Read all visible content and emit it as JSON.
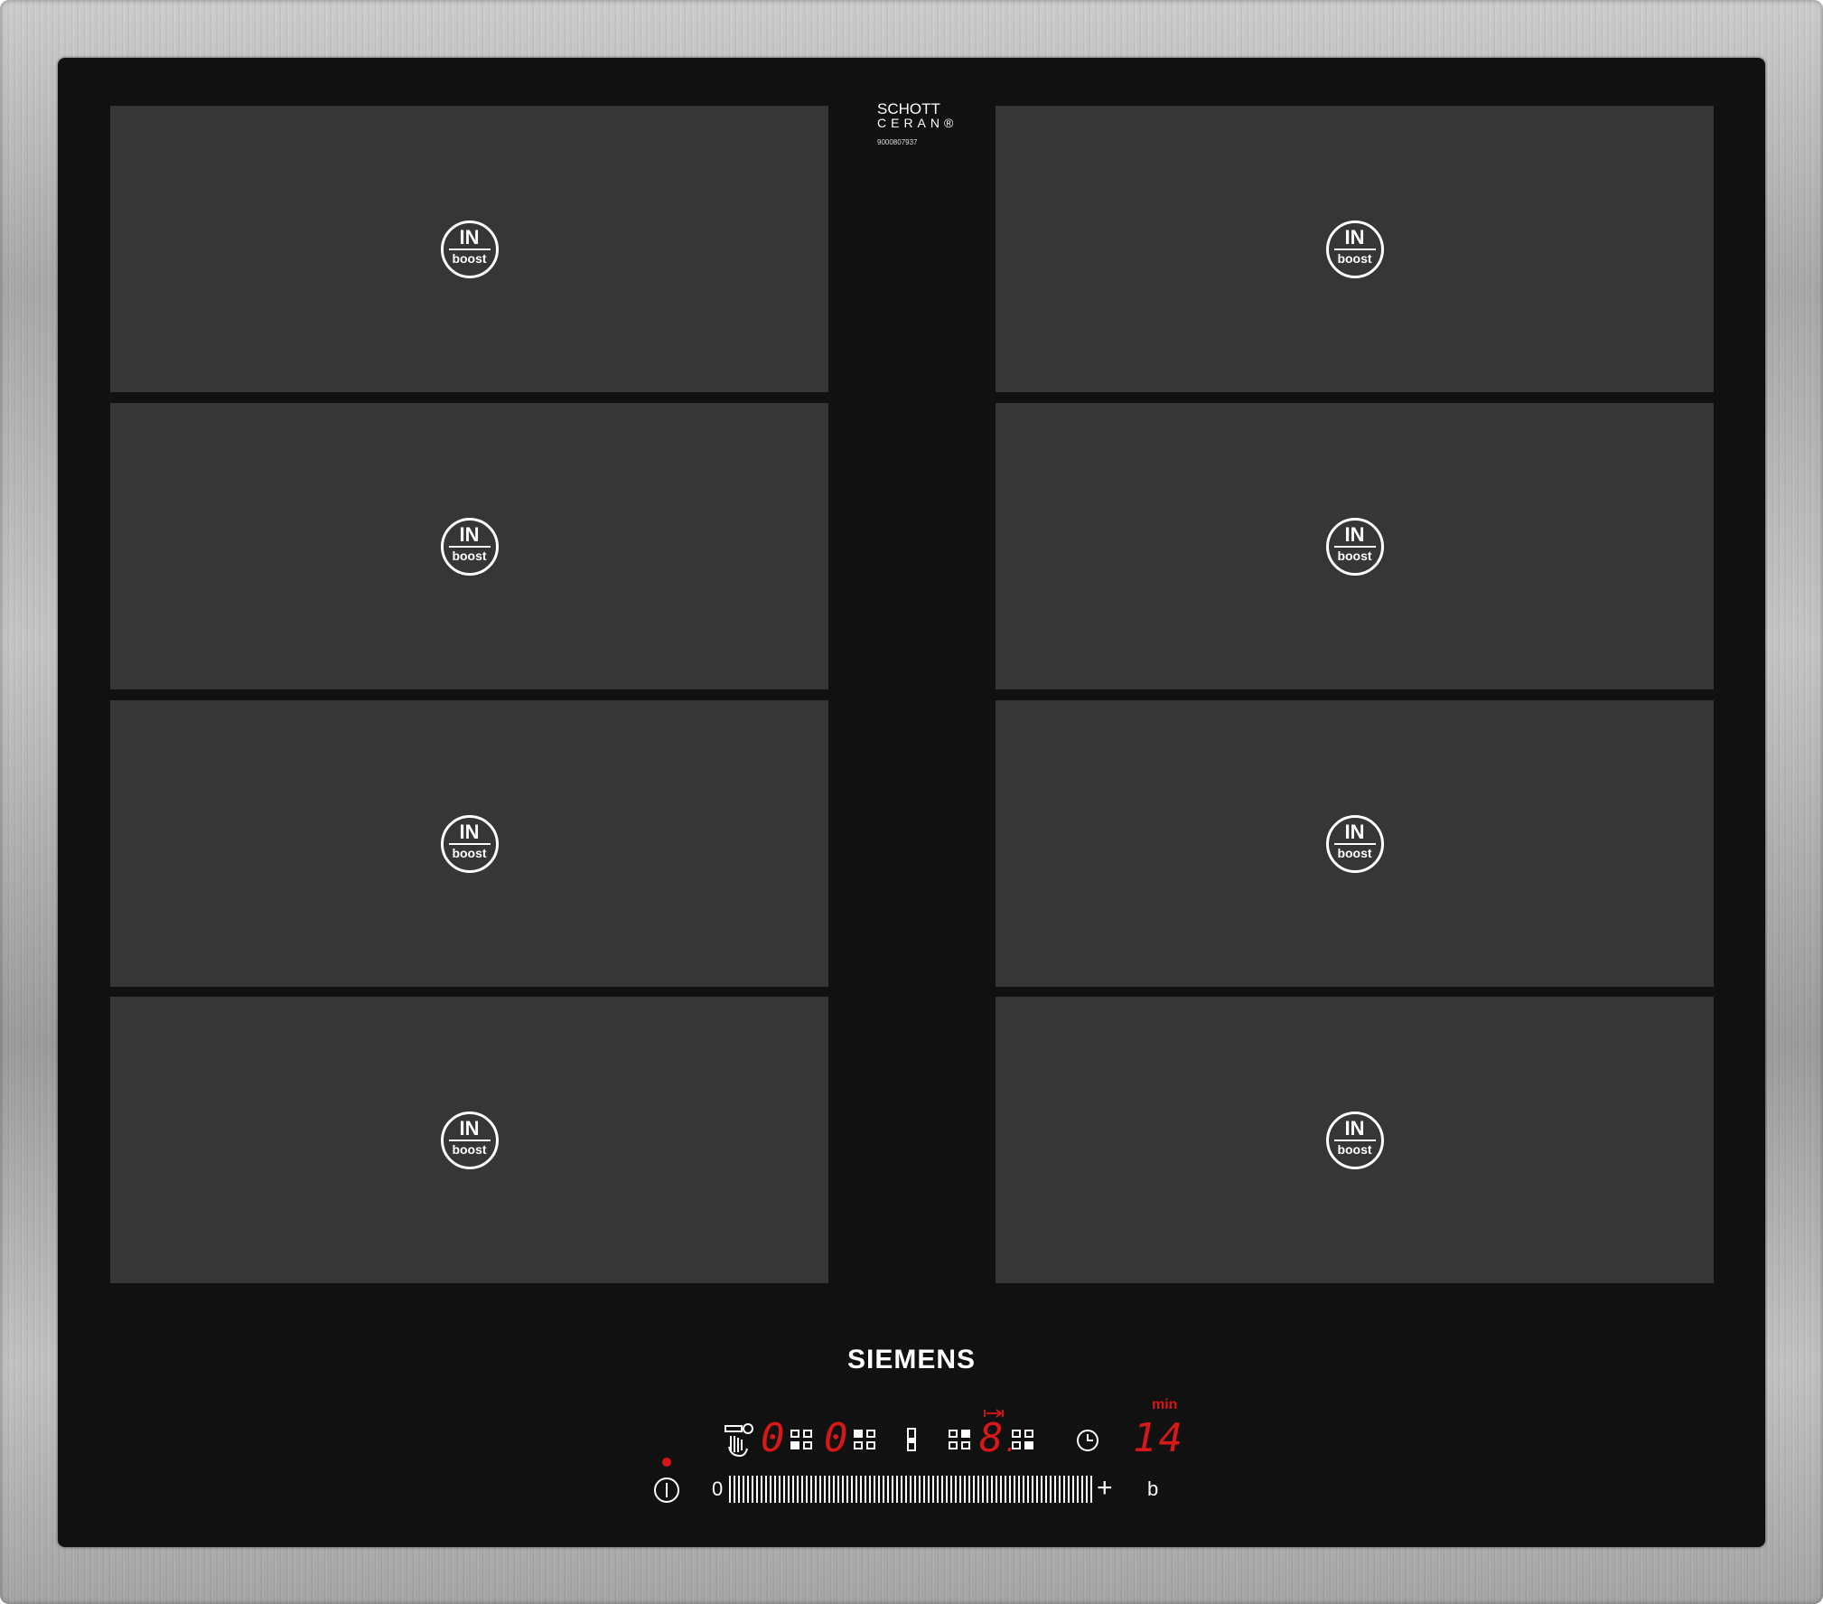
{
  "logo": {
    "line1": "SCHOTT",
    "line2": "CERAN®",
    "serial": "9000807937"
  },
  "brand": "SIEMENS",
  "zones": {
    "boost_top": "IN",
    "boost_bottom": "boost",
    "count": 8
  },
  "controls": {
    "left_display": "0",
    "right_display": "0",
    "center_display": "8",
    "center_dot": ".",
    "timer_unit": "min",
    "timer_value": "14",
    "slider_min": "0",
    "slider_plus": "+",
    "boost_key": "b"
  },
  "colors": {
    "display_red": "#d81818",
    "zone_gray": "#363636",
    "glass_black": "#111111"
  }
}
